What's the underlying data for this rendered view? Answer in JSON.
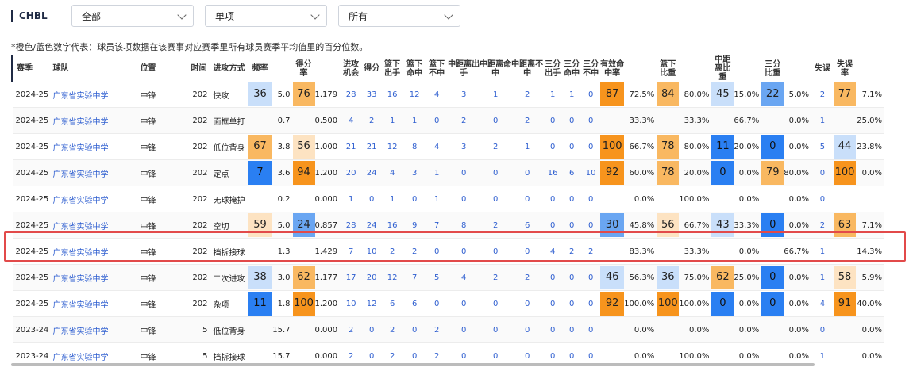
{
  "brand": "CHBL",
  "filters": [
    {
      "label": "全部"
    },
    {
      "label": "单项"
    },
    {
      "label": "所有"
    }
  ],
  "note": "*橙色/蓝色数字代表：球员该项数据在该赛事对应赛季里所有球员赛季平均值里的百分位数。",
  "headers": [
    "赛季",
    "球队",
    "位置",
    "时间",
    "进攻方式",
    "频率",
    "",
    "得分率",
    "",
    "进攻机会",
    "得分",
    "篮下出手",
    "篮下命中",
    "篮下不中",
    "中距离出手",
    "中距离命中",
    "中距离不中",
    "三分出手",
    "三分命中",
    "三分不中",
    "有效命中率",
    "",
    "篮下比重",
    "",
    "中距离比重",
    "",
    "三分比重",
    "",
    "失误",
    "失误率",
    ""
  ],
  "rows": [
    [
      "2024-25",
      "广东省实验中学",
      "中锋",
      "202",
      "快攻",
      "36",
      "5.0",
      "76",
      "1.179",
      "28",
      "33",
      "16",
      "12",
      "4",
      "3",
      "1",
      "2",
      "1",
      "1",
      "0",
      "87",
      "72.5%",
      "84",
      "80.0%",
      "45",
      "15.0%",
      "22",
      "5.0%",
      "2",
      "77",
      "7.1%"
    ],
    [
      "2024-25",
      "广东省实验中学",
      "中锋",
      "202",
      "面框单打",
      "",
      "0.7",
      "",
      "0.500",
      "4",
      "2",
      "1",
      "1",
      "0",
      "2",
      "0",
      "2",
      "0",
      "0",
      "0",
      "",
      "33.3%",
      "",
      "33.3%",
      "",
      "66.7%",
      "",
      "0.0%",
      "1",
      "",
      "25.0%"
    ],
    [
      "2024-25",
      "广东省实验中学",
      "中锋",
      "202",
      "低位背身",
      "67",
      "3.8",
      "56",
      "1.000",
      "21",
      "21",
      "12",
      "8",
      "4",
      "3",
      "2",
      "1",
      "0",
      "0",
      "0",
      "100",
      "66.7%",
      "78",
      "80.0%",
      "11",
      "20.0%",
      "0",
      "0.0%",
      "5",
      "44",
      "23.8%"
    ],
    [
      "2024-25",
      "广东省实验中学",
      "中锋",
      "202",
      "定点",
      "7",
      "3.6",
      "94",
      "1.200",
      "20",
      "24",
      "4",
      "3",
      "1",
      "0",
      "0",
      "0",
      "16",
      "6",
      "10",
      "92",
      "60.0%",
      "78",
      "20.0%",
      "0",
      "0.0%",
      "79",
      "80.0%",
      "0",
      "100",
      "0.0%"
    ],
    [
      "2024-25",
      "广东省实验中学",
      "中锋",
      "202",
      "无球掩护",
      "",
      "0.2",
      "",
      "0.000",
      "1",
      "0",
      "1",
      "0",
      "1",
      "0",
      "0",
      "0",
      "0",
      "0",
      "0",
      "",
      "0.0%",
      "",
      "100.0%",
      "",
      "0.0%",
      "",
      "0.0%",
      "0",
      "",
      ""
    ],
    [
      "2024-25",
      "广东省实验中学",
      "中锋",
      "202",
      "空切",
      "59",
      "5.0",
      "24",
      "0.857",
      "28",
      "24",
      "16",
      "9",
      "7",
      "8",
      "2",
      "6",
      "0",
      "0",
      "0",
      "30",
      "45.8%",
      "56",
      "66.7%",
      "43",
      "33.3%",
      "0",
      "0.0%",
      "2",
      "63",
      "7.1%"
    ],
    [
      "2024-25",
      "广东省实验中学",
      "中锋",
      "202",
      "挡拆接球",
      "",
      "1.3",
      "",
      "1.429",
      "7",
      "10",
      "2",
      "2",
      "0",
      "0",
      "0",
      "0",
      "4",
      "2",
      "2",
      "",
      "83.3%",
      "",
      "33.3%",
      "",
      "0.0%",
      "",
      "66.7%",
      "1",
      "",
      "14.3%"
    ],
    [
      "2024-25",
      "广东省实验中学",
      "中锋",
      "202",
      "二次进攻",
      "38",
      "3.0",
      "62",
      "1.177",
      "17",
      "20",
      "12",
      "7",
      "5",
      "4",
      "2",
      "2",
      "0",
      "0",
      "0",
      "46",
      "56.3%",
      "36",
      "75.0%",
      "62",
      "25.0%",
      "0",
      "0.0%",
      "1",
      "58",
      "5.9%"
    ],
    [
      "2024-25",
      "广东省实验中学",
      "中锋",
      "202",
      "杂项",
      "11",
      "1.8",
      "100",
      "1.200",
      "10",
      "12",
      "6",
      "6",
      "0",
      "0",
      "0",
      "0",
      "0",
      "0",
      "0",
      "92",
      "100.0%",
      "100",
      "100.0%",
      "0",
      "0.0%",
      "0",
      "0.0%",
      "4",
      "91",
      "40.0%"
    ],
    [
      "2023-24",
      "广东省实验中学",
      "中锋",
      "5",
      "低位背身",
      "",
      "15.7",
      "",
      "0.000",
      "2",
      "0",
      "2",
      "0",
      "2",
      "0",
      "0",
      "0",
      "0",
      "0",
      "0",
      "",
      "0.0%",
      "",
      "0.0%",
      "",
      "0.0%",
      "",
      "0.0%",
      "0",
      "",
      "0.0%"
    ],
    [
      "2023-24",
      "广东省实验中学",
      "中锋",
      "5",
      "挡拆接球",
      "",
      "15.7",
      "",
      "0.000",
      "2",
      "0",
      "2",
      "0",
      "2",
      "0",
      "0",
      "0",
      "0",
      "0",
      "0",
      "",
      "0.0%",
      "",
      "100.0%",
      "",
      "0.0%",
      "",
      "0.0%",
      "1",
      "",
      "0.0%"
    ]
  ],
  "colors": {
    "orange_strong": "#f7941d",
    "orange_mid": "#f9b861",
    "orange_light": "#fde3c2",
    "blue_strong": "#2a7ff2",
    "blue_mid": "#6aa6f2",
    "blue_light": "#c9dffa",
    "highlight_border": "#e24a4a",
    "link_blue": "#2f5fd0"
  }
}
